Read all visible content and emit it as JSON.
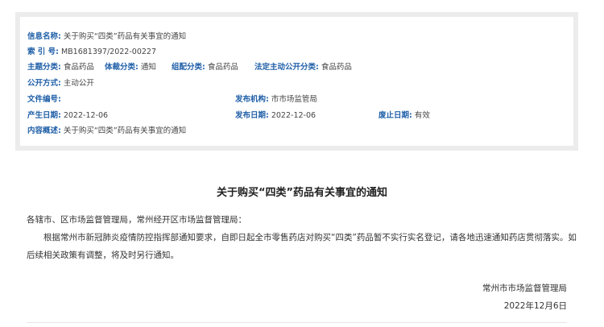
{
  "info": {
    "name_label": "信息名称:",
    "name_value": "关于购买“四类”药品有关事宜的通知",
    "index_label": "索 引 号:",
    "index_value": "MB1681397/2022-00227",
    "topic_label": "主题分类:",
    "topic_value": "食品药品",
    "genre_label": "体裁分类:",
    "genre_value": "通知",
    "org_cat_label": "组配分类:",
    "org_cat_value": "食品药品",
    "statutory_label": "法定主动公开分类:",
    "statutory_value": "食品药品",
    "disclosure_label": "公开方式:",
    "disclosure_value": "主动公开",
    "docno_label": "文件编号:",
    "docno_value": "",
    "issuer_label": "发布机构:",
    "issuer_value": "市市场监管局",
    "created_label": "产生日期:",
    "created_value": "2022-12-06",
    "published_label": "发布日期:",
    "published_value": "2022-12-06",
    "expiry_label": "废止日期:",
    "expiry_value": "有效",
    "summary_label": "内容概述:",
    "summary_value": "关于购买“四类”药品有关事宜的通知"
  },
  "article": {
    "title": "关于购买“四类”药品有关事宜的通知",
    "salutation": "各辖市、区市场监督管理局，常州经开区市场监督管理局：",
    "body": "根据常州市新冠肺炎疫情防控指挥部通知要求，自即日起全市零售药店对购买“四类”药品暂不实行实名登记，请各地迅速通知药店贯彻落实。如后续相关政策有调整，将及时另行通知。",
    "signature": "常州市市场监督管理局",
    "date": "2022年12月6日"
  }
}
